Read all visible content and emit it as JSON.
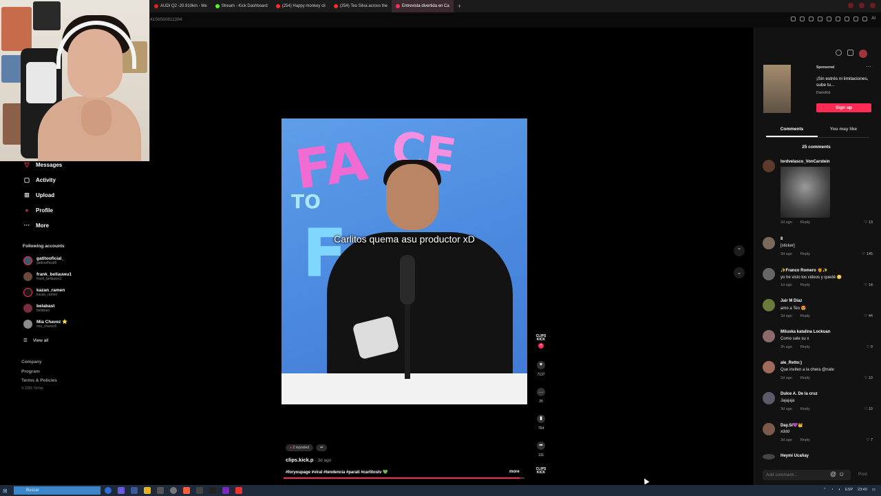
{
  "browser": {
    "tabs": [
      {
        "label": "AUDI Q2 -20.910km - Me",
        "color": "#e02020"
      },
      {
        "label": "Stream - Kick Dashboard",
        "color": "#53fc18"
      },
      {
        "label": "(254) Happy monkey cli",
        "color": "#ff2b2b"
      },
      {
        "label": "(254) Teo Silva across the",
        "color": "#ff2b2b"
      },
      {
        "label": "Entrevista divertida en Ca",
        "color": "#fe2c55"
      }
    ],
    "new_tab": "+",
    "url_fragment": "4156560811284",
    "ai_label": "AI"
  },
  "sidebar": {
    "nav": [
      {
        "label": "Messages",
        "icon": "paper-plane-icon",
        "glyph": "▽"
      },
      {
        "label": "Activity",
        "icon": "inbox-icon",
        "glyph": "▢"
      },
      {
        "label": "Upload",
        "icon": "plus-square-icon",
        "glyph": "⊞"
      },
      {
        "label": "Profile",
        "icon": "avatar-icon",
        "glyph": "●"
      },
      {
        "label": "More",
        "icon": "ellipsis-icon",
        "glyph": "···"
      }
    ],
    "following_title": "Following accounts",
    "accounts": [
      {
        "name": "gatitooficial_",
        "handle": "gatitoofficial8"
      },
      {
        "name": "frank_bellauwu1",
        "handle": "frank_bellauwu1"
      },
      {
        "name": "kazan_ramen",
        "handle": "kazan_ramen"
      },
      {
        "name": "belabast",
        "handle": "belabast"
      },
      {
        "name": "Mia Chavez ⭐",
        "handle": "mia_chavez5"
      }
    ],
    "view_all": "View all",
    "footer_links": [
      "Company",
      "Program",
      "Terms & Policies"
    ],
    "copyright": "© 2026 TikTok"
  },
  "video": {
    "caption": "Carlitos quema asu productor xD",
    "brand_text": "FACE TO FACE",
    "repost_label": "2 reposted",
    "author": "clips.kick.p",
    "posted": "· 3d ago",
    "description": "#foryoupage #viral #tendencia #parati #carlitostv 💚",
    "more": "more",
    "progress": 0.98,
    "side_logo": "CLIPS KICK",
    "actions": [
      {
        "icon": "heart-icon",
        "glyph": "♥",
        "count": "7137"
      },
      {
        "icon": "comment-icon",
        "glyph": "…",
        "count": "25"
      },
      {
        "icon": "bookmark-icon",
        "glyph": "▮",
        "count": "764"
      },
      {
        "icon": "share-icon",
        "glyph": "➦",
        "count": "131"
      }
    ]
  },
  "panel": {
    "ad": {
      "sponsored": "Sponsored",
      "title": "¡Sin estrés ni limitaciones, sube tu...",
      "brand": "DistroKid",
      "cta": "Sign up"
    },
    "tabs": [
      "Comments",
      "You may like"
    ],
    "comment_count": "25 comments",
    "comments": [
      {
        "user": "lordvelasco_VonCarstein",
        "text": "",
        "time": "2d ago",
        "reply": "Reply",
        "likes": "13"
      },
      {
        "user": "8",
        "text": "[sticker]",
        "time": "3d ago",
        "reply": "Reply",
        "likes": "145"
      },
      {
        "user": "✨Franco Romero 🍯✨",
        "text": "yo he visto los videos y quedé 😳",
        "time": "1d ago",
        "reply": "Reply",
        "likes": "14"
      },
      {
        "user": "Jair M Diaz",
        "text": "amo a Teo 😍",
        "time": "3d ago",
        "reply": "Reply",
        "likes": "44"
      },
      {
        "user": "Miluska katalina Lockuan",
        "text": "Como sale su x",
        "time": "2h ago",
        "reply": "Reply",
        "likes": "0"
      },
      {
        "user": "ale_Retto:)",
        "text": "Que inviten a la chera @nate",
        "time": "2d ago",
        "reply": "Reply",
        "likes": "10"
      },
      {
        "user": "Dulce A. De la cruz",
        "text": "Jajajaja",
        "time": "3d ago",
        "reply": "Reply",
        "likes": "10"
      },
      {
        "user": "Day.Sí💜👑",
        "text": "xddd",
        "time": "3d ago",
        "reply": "Reply",
        "likes": "7"
      },
      {
        "user": "Heymi Ucañay",
        "text": "",
        "time": "",
        "reply": "",
        "likes": ""
      }
    ],
    "add_placeholder": "Add comment...",
    "post": "Post"
  },
  "taskbar": {
    "search": "Buscar",
    "lang": "ESP",
    "time": "23:40"
  }
}
